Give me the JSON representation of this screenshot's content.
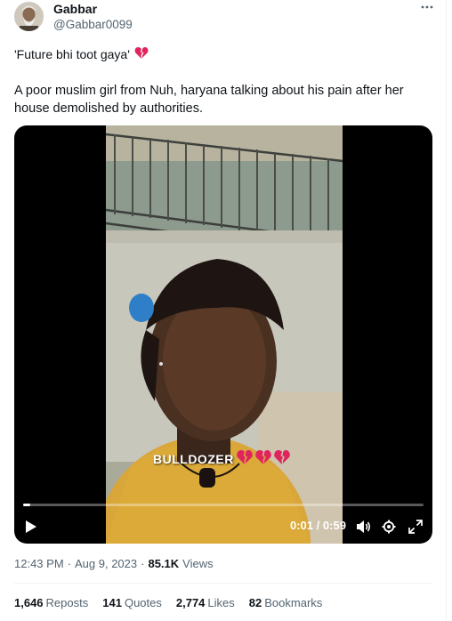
{
  "author": {
    "name": "Gabbar",
    "handle": "@Gabbar0099"
  },
  "tweet": {
    "line1": "'Future bhi toot gaya'",
    "line2": "A poor muslim girl from Nuh, haryana talking about his pain after her house demolished by authorities."
  },
  "video": {
    "overlay_text": "BULLDOZER",
    "current_time": "0:01",
    "separator": "/",
    "duration": "0:59",
    "progress_fraction": 0.017
  },
  "meta": {
    "time": "12:43 PM",
    "dot1": "·",
    "date": "Aug 9, 2023",
    "dot2": "·",
    "views_count": "85.1K",
    "views_label": "Views"
  },
  "stats": {
    "reposts_count": "1,646",
    "reposts_label": "Reposts",
    "quotes_count": "141",
    "quotes_label": "Quotes",
    "likes_count": "2,774",
    "likes_label": "Likes",
    "bookmarks_count": "82",
    "bookmarks_label": "Bookmarks"
  },
  "colors": {
    "broken_heart": "#e0245e",
    "secondary_text": "#536471"
  }
}
